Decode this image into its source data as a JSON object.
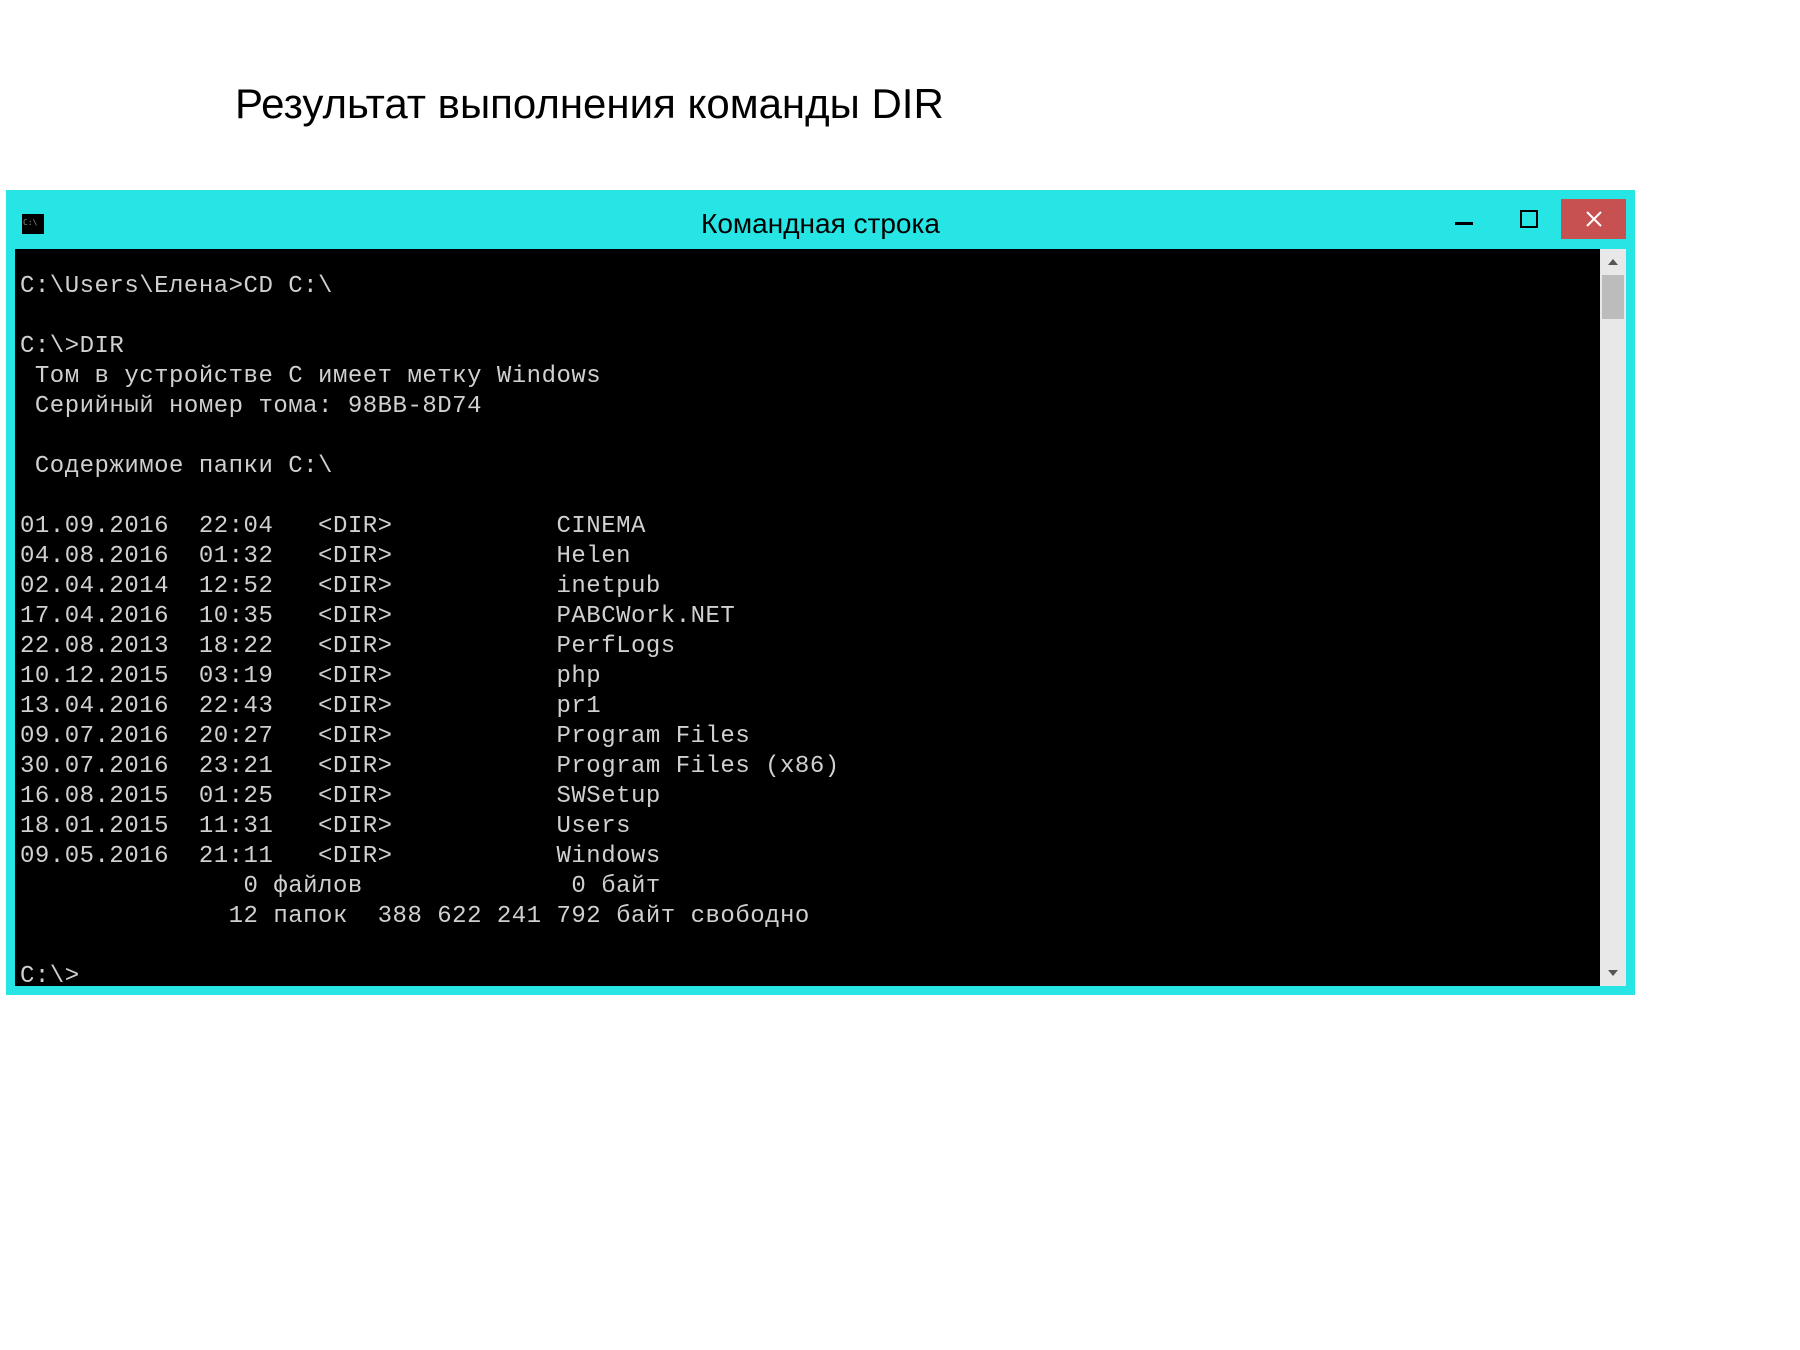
{
  "page_heading": "Результат выполнения команды DIR",
  "window_title": "Командная строка",
  "prompt1": "C:\\Users\\Елена>CD C:\\",
  "blank": "",
  "prompt2": "C:\\>DIR",
  "volume": " Том в устройстве C имеет метку Windows",
  "serial": " Серийный номер тома: 98BB-8D74",
  "contents": " Содержимое папки C:\\",
  "entries": [
    {
      "date": "01.09.2016",
      "time": "22:04",
      "type": "<DIR>",
      "name": "CINEMA"
    },
    {
      "date": "04.08.2016",
      "time": "01:32",
      "type": "<DIR>",
      "name": "Helen"
    },
    {
      "date": "02.04.2014",
      "time": "12:52",
      "type": "<DIR>",
      "name": "inetpub"
    },
    {
      "date": "17.04.2016",
      "time": "10:35",
      "type": "<DIR>",
      "name": "PABCWork.NET"
    },
    {
      "date": "22.08.2013",
      "time": "18:22",
      "type": "<DIR>",
      "name": "PerfLogs"
    },
    {
      "date": "10.12.2015",
      "time": "03:19",
      "type": "<DIR>",
      "name": "php"
    },
    {
      "date": "13.04.2016",
      "time": "22:43",
      "type": "<DIR>",
      "name": "pr1"
    },
    {
      "date": "09.07.2016",
      "time": "20:27",
      "type": "<DIR>",
      "name": "Program Files"
    },
    {
      "date": "30.07.2016",
      "time": "23:21",
      "type": "<DIR>",
      "name": "Program Files (x86)"
    },
    {
      "date": "16.08.2015",
      "time": "01:25",
      "type": "<DIR>",
      "name": "SWSetup"
    },
    {
      "date": "18.01.2015",
      "time": "11:31",
      "type": "<DIR>",
      "name": "Users"
    },
    {
      "date": "09.05.2016",
      "time": "21:11",
      "type": "<DIR>",
      "name": "Windows"
    }
  ],
  "summary1": "               0 файлов              0 байт",
  "summary2": "              12 папок  388 622 241 792 байт свободно",
  "prompt3": "C:\\>"
}
